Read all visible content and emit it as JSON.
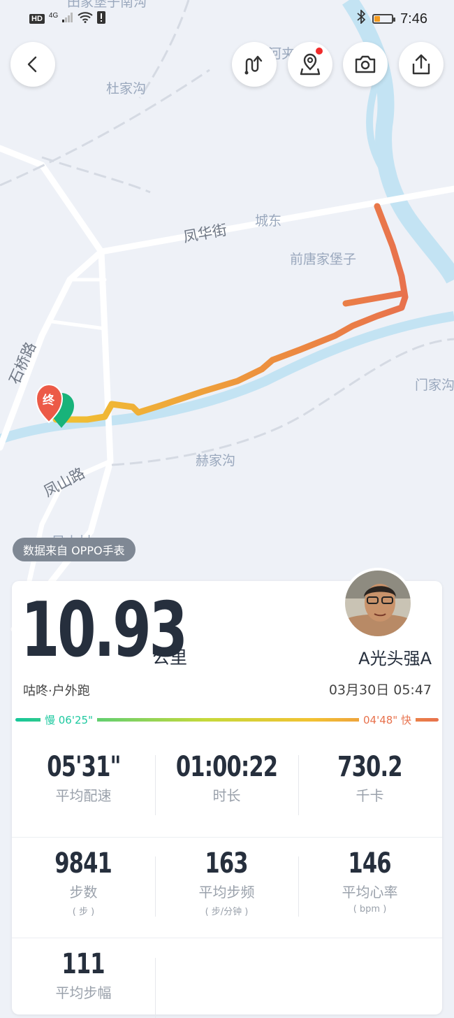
{
  "status_bar": {
    "hd": "HD",
    "network": "4G",
    "time": "7:46"
  },
  "map": {
    "labels": {
      "top_partial": "田家堡子南沟",
      "dujiagou": "杜家沟",
      "top_right": "河夹",
      "fenghuajie": "凤华街",
      "chengdong": "城东",
      "qiantang": "前唐家堡子",
      "shiqiao": "石桥路",
      "menjia": "门家沟",
      "hejiagou": "赫家沟",
      "fengshanlu": "凤山路",
      "fengshancun": "凤山村"
    },
    "end_marker": "终",
    "route_colors": [
      "#f0c232",
      "#efa83a",
      "#ec8a40",
      "#e8724d"
    ]
  },
  "source_label": "数据来自 OPPO手表",
  "summary": {
    "distance": "10.93",
    "unit": "公里",
    "user": "A光头强A",
    "activity": "咕咚·户外跑",
    "datetime": "03月30日 05:47"
  },
  "pace_legend": {
    "slow": "慢 06'25\"",
    "fast": "04'48\" 快",
    "colors": [
      "#16c79a",
      "#c6d93a",
      "#f2c232",
      "#e8724d"
    ]
  },
  "stats": [
    {
      "value": "05'31\"",
      "label": "平均配速",
      "unit": ""
    },
    {
      "value": "01:00:22",
      "label": "时长",
      "unit": ""
    },
    {
      "value": "730.2",
      "label": "千卡",
      "unit": ""
    },
    {
      "value": "9841",
      "label": "步数",
      "unit": "( 步 )"
    },
    {
      "value": "163",
      "label": "平均步频",
      "unit": "( 步/分钟 )"
    },
    {
      "value": "146",
      "label": "平均心率",
      "unit": "( bpm )"
    },
    {
      "value": "111",
      "label": "平均步幅",
      "unit": ""
    }
  ],
  "colors": {
    "text_dark": "#262f3d",
    "river": "#c3e3f3",
    "accent_red": "#f02b2b"
  }
}
